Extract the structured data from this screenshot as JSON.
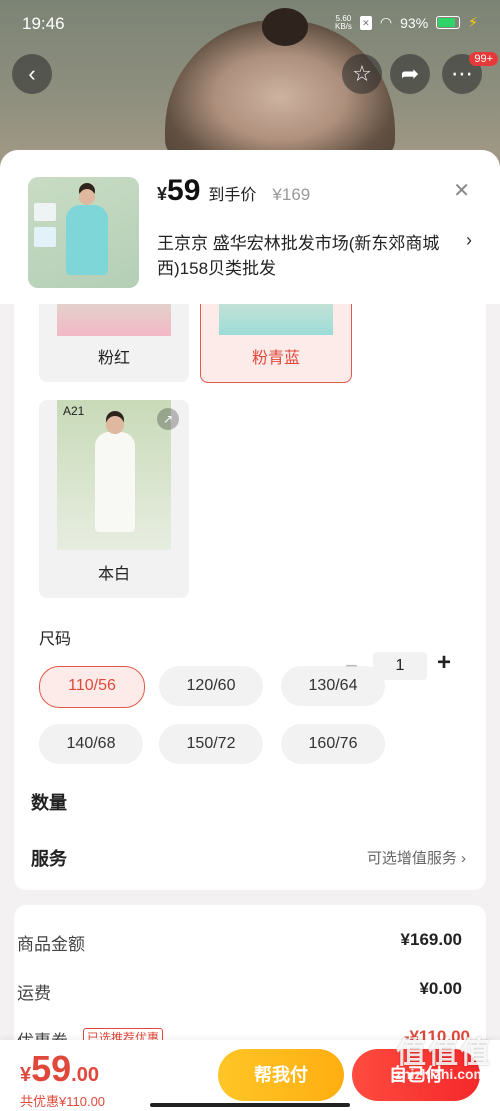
{
  "status": {
    "time": "19:46",
    "net_speed": "5.60\nKB/s",
    "battery": "93%"
  },
  "nav": {
    "badge": "99+"
  },
  "header": {
    "currency": "¥",
    "price": "59",
    "price_label": "到手价",
    "original_price": "¥169",
    "shop": "王京京  盛华宏林批发市场(新东郊商城西)158贝类批发"
  },
  "colors": [
    {
      "label": "粉红",
      "selected": false
    },
    {
      "label": "粉青蓝",
      "selected": true
    },
    {
      "label": "本白",
      "selected": false,
      "code": "A21"
    }
  ],
  "size": {
    "title": "尺码",
    "options": [
      "110/56",
      "120/60",
      "130/64",
      "140/68",
      "150/72",
      "160/76"
    ],
    "selected": "110/56"
  },
  "quantity": {
    "label": "数量",
    "value": "1",
    "minus": "−",
    "plus": "+"
  },
  "service": {
    "label": "服务",
    "link": "可选增值服务"
  },
  "summary": {
    "goods_label": "商品金额",
    "goods_value": "¥169.00",
    "shipping_label": "运费",
    "shipping_value": "¥0.00",
    "coupon_label": "优惠券",
    "coupon_tag": "已选推荐优惠",
    "coupon_value": "-¥110.00"
  },
  "bottom": {
    "yen": "¥",
    "int": "59",
    "dec": ".00",
    "discount": "共优惠¥110.00",
    "help_pay": "帮我付",
    "self_pay": "自己付"
  },
  "watermark": {
    "main": "值值值",
    "sub": "zhizhizhi.com"
  },
  "accent": {
    "red": "#e0483b",
    "yellow": "#ffb81a"
  }
}
